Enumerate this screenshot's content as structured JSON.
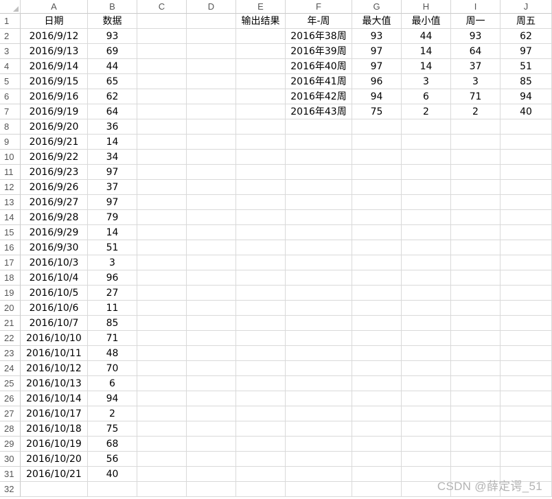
{
  "columns": [
    "A",
    "B",
    "C",
    "D",
    "E",
    "F",
    "G",
    "H",
    "I",
    "J"
  ],
  "rows": [
    [
      "日期",
      "数据",
      "",
      "",
      "输出结果",
      "年-周",
      "最大值",
      "最小值",
      "周一",
      "周五"
    ],
    [
      "2016/9/12",
      "93",
      "",
      "",
      "",
      "2016年38周",
      "93",
      "44",
      "93",
      "62"
    ],
    [
      "2016/9/13",
      "69",
      "",
      "",
      "",
      "2016年39周",
      "97",
      "14",
      "64",
      "97"
    ],
    [
      "2016/9/14",
      "44",
      "",
      "",
      "",
      "2016年40周",
      "97",
      "14",
      "37",
      "51"
    ],
    [
      "2016/9/15",
      "65",
      "",
      "",
      "",
      "2016年41周",
      "96",
      "3",
      "3",
      "85"
    ],
    [
      "2016/9/16",
      "62",
      "",
      "",
      "",
      "2016年42周",
      "94",
      "6",
      "71",
      "94"
    ],
    [
      "2016/9/19",
      "64",
      "",
      "",
      "",
      "2016年43周",
      "75",
      "2",
      "2",
      "40"
    ],
    [
      "2016/9/20",
      "36",
      "",
      "",
      "",
      "",
      "",
      "",
      "",
      ""
    ],
    [
      "2016/9/21",
      "14",
      "",
      "",
      "",
      "",
      "",
      "",
      "",
      ""
    ],
    [
      "2016/9/22",
      "34",
      "",
      "",
      "",
      "",
      "",
      "",
      "",
      ""
    ],
    [
      "2016/9/23",
      "97",
      "",
      "",
      "",
      "",
      "",
      "",
      "",
      ""
    ],
    [
      "2016/9/26",
      "37",
      "",
      "",
      "",
      "",
      "",
      "",
      "",
      ""
    ],
    [
      "2016/9/27",
      "97",
      "",
      "",
      "",
      "",
      "",
      "",
      "",
      ""
    ],
    [
      "2016/9/28",
      "79",
      "",
      "",
      "",
      "",
      "",
      "",
      "",
      ""
    ],
    [
      "2016/9/29",
      "14",
      "",
      "",
      "",
      "",
      "",
      "",
      "",
      ""
    ],
    [
      "2016/9/30",
      "51",
      "",
      "",
      "",
      "",
      "",
      "",
      "",
      ""
    ],
    [
      "2016/10/3",
      "3",
      "",
      "",
      "",
      "",
      "",
      "",
      "",
      ""
    ],
    [
      "2016/10/4",
      "96",
      "",
      "",
      "",
      "",
      "",
      "",
      "",
      ""
    ],
    [
      "2016/10/5",
      "27",
      "",
      "",
      "",
      "",
      "",
      "",
      "",
      ""
    ],
    [
      "2016/10/6",
      "11",
      "",
      "",
      "",
      "",
      "",
      "",
      "",
      ""
    ],
    [
      "2016/10/7",
      "85",
      "",
      "",
      "",
      "",
      "",
      "",
      "",
      ""
    ],
    [
      "2016/10/10",
      "71",
      "",
      "",
      "",
      "",
      "",
      "",
      "",
      ""
    ],
    [
      "2016/10/11",
      "48",
      "",
      "",
      "",
      "",
      "",
      "",
      "",
      ""
    ],
    [
      "2016/10/12",
      "70",
      "",
      "",
      "",
      "",
      "",
      "",
      "",
      ""
    ],
    [
      "2016/10/13",
      "6",
      "",
      "",
      "",
      "",
      "",
      "",
      "",
      ""
    ],
    [
      "2016/10/14",
      "94",
      "",
      "",
      "",
      "",
      "",
      "",
      "",
      ""
    ],
    [
      "2016/10/17",
      "2",
      "",
      "",
      "",
      "",
      "",
      "",
      "",
      ""
    ],
    [
      "2016/10/18",
      "75",
      "",
      "",
      "",
      "",
      "",
      "",
      "",
      ""
    ],
    [
      "2016/10/19",
      "68",
      "",
      "",
      "",
      "",
      "",
      "",
      "",
      ""
    ],
    [
      "2016/10/20",
      "56",
      "",
      "",
      "",
      "",
      "",
      "",
      "",
      ""
    ],
    [
      "2016/10/21",
      "40",
      "",
      "",
      "",
      "",
      "",
      "",
      "",
      ""
    ],
    [
      "",
      "",
      "",
      "",
      "",
      "",
      "",
      "",
      "",
      ""
    ]
  ],
  "watermark": "CSDN @薛定谔_51"
}
